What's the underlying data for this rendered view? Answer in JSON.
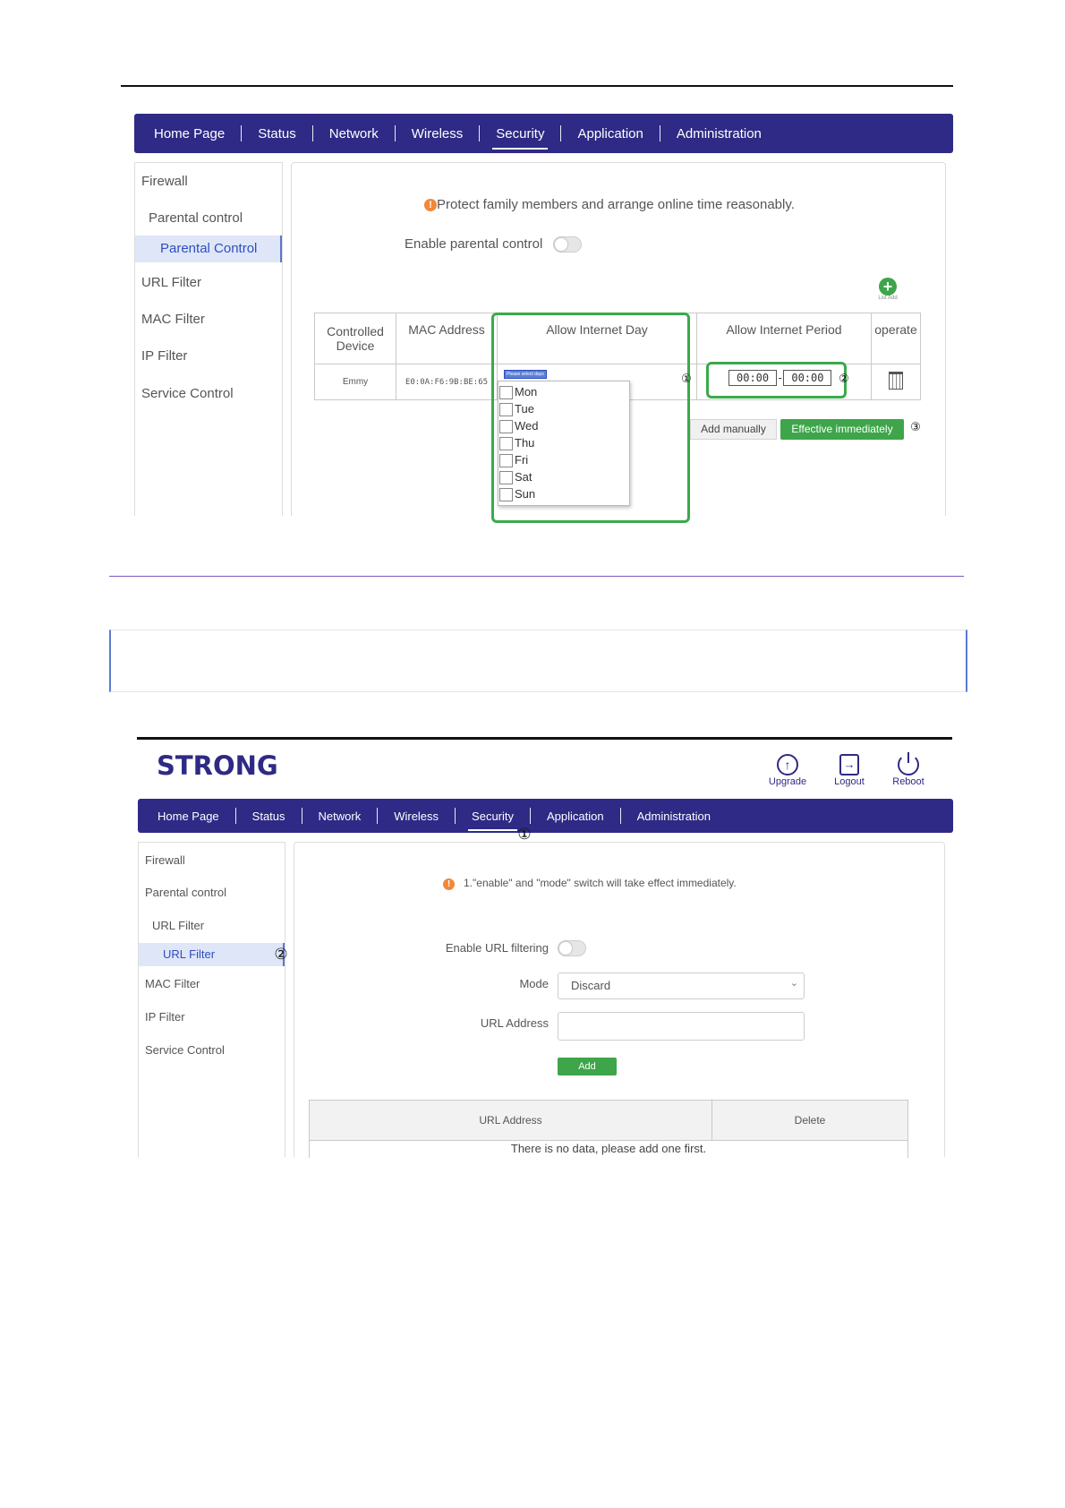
{
  "screen1": {
    "nav": [
      "Home Page",
      "Status",
      "Network",
      "Wireless",
      "Security",
      "Application",
      "Administration"
    ],
    "active_nav": "Security",
    "sidebar": {
      "firewall": "Firewall",
      "parental": "Parental control",
      "parental_sub": "Parental Control",
      "url": "URL Filter",
      "mac": "MAC Filter",
      "ip": "IP Filter",
      "service": "Service Control"
    },
    "notice": "Protect family members and arrange online time reasonably.",
    "enable_label": "Enable parental control",
    "list_add": "List Add",
    "table_headers": [
      "Controlled Device",
      "MAC Address",
      "Allow Internet Day",
      "Allow Internet Period",
      "operate"
    ],
    "row": {
      "device": "Emmy",
      "mac": "E0:0A:F6:9B:BE:65",
      "day_select": "Please select days",
      "start": "00:00",
      "dash": "-",
      "end": "00:00"
    },
    "days": [
      "Mon",
      "Tue",
      "Wed",
      "Thu",
      "Fri",
      "Sat",
      "Sun"
    ],
    "add_manually": "Add manually",
    "effective": "Effective immediately",
    "callouts": [
      "①",
      "②",
      "③"
    ],
    "colors": {
      "nav_bg": "#2e2a85",
      "highlight": "#3aaa4b"
    }
  },
  "screen2": {
    "brand": "STRONG",
    "top_actions": [
      "Upgrade",
      "Logout",
      "Reboot"
    ],
    "nav": [
      "Home Page",
      "Status",
      "Network",
      "Wireless",
      "Security",
      "Application",
      "Administration"
    ],
    "active_nav": "Security",
    "sidebar": {
      "firewall": "Firewall",
      "parental": "Parental control",
      "url": "URL Filter",
      "url_sub": "URL Filter",
      "mac": "MAC Filter",
      "ip": "IP Filter",
      "service": "Service Control"
    },
    "notice": "1.\"enable\" and \"mode\" switch will take effect immediately.",
    "enable_label": "Enable URL filtering",
    "mode_label": "Mode",
    "mode_value": "Discard",
    "url_label": "URL Address",
    "url_value": "",
    "add": "Add",
    "table_headers": [
      "URL Address",
      "Delete"
    ],
    "empty": "There is no data, please add one first.",
    "callouts": [
      "①",
      "②"
    ]
  }
}
